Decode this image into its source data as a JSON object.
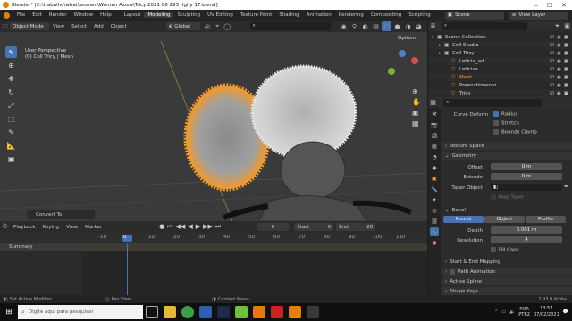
{
  "titlebar": {
    "title": "Blender* [C:\\trabalho\\what\\women\\Women Azora\\Tricy 2021 08 293 rigify 17.blend]"
  },
  "menus": [
    "File",
    "Edit",
    "Render",
    "Window",
    "Help"
  ],
  "workspaces": [
    "Layout",
    "Modeling",
    "Sculpting",
    "UV Editing",
    "Texture Paint",
    "Shading",
    "Animation",
    "Rendering",
    "Compositing",
    "Scripting"
  ],
  "scene": {
    "scene_label": "Scene",
    "view_layer_label": "View Layer"
  },
  "viewport": {
    "mode": "Object Mode",
    "menu": [
      "View",
      "Select",
      "Add",
      "Object"
    ],
    "orientation": "Global",
    "view_name": "User Perspective",
    "object_info": "(0) Coll Tricy | Mesh",
    "options_label": "Options",
    "convert_label": "Convert To"
  },
  "outliner": {
    "items": [
      {
        "label": "Scene Collection",
        "indent": 0
      },
      {
        "label": "Coll Studio",
        "indent": 1
      },
      {
        "label": "Coll Tricy",
        "indent": 1
      },
      {
        "label": "Leticia_ad",
        "indent": 2
      },
      {
        "label": "Leticias",
        "indent": 2
      },
      {
        "label": "Mesh",
        "indent": 2,
        "highlight": true
      },
      {
        "label": "Preenchimento",
        "indent": 2
      },
      {
        "label": "Tricy",
        "indent": 2
      }
    ]
  },
  "properties": {
    "curve_deform_label": "Curve Deform",
    "radius_label": "Radius",
    "stretch_label": "Stretch",
    "bounds_clamp_label": "Bounds Clamp",
    "texture_space": "Texture Space",
    "geometry": "Geometry",
    "offset_label": "Offset",
    "offset_value": "0 m",
    "extrude_label": "Extrude",
    "extrude_value": "0 m",
    "taper_label": "Taper Object",
    "map_taper_label": "Map Taper",
    "bevel": "Bevel",
    "bevel_tabs": [
      "Round",
      "Object",
      "Profile"
    ],
    "depth_label": "Depth",
    "depth_value": "0.001 m",
    "resolution_label": "Resolution",
    "resolution_value": "4",
    "fill_caps_label": "Fill Caps",
    "start_end_label": "Start & End Mapping",
    "path_anim": "Path Animation",
    "active_spline": "Active Spline",
    "shape_keys": "Shape Keys"
  },
  "timeline": {
    "menus": [
      "Playback",
      "Keying",
      "View",
      "Marker"
    ],
    "current_frame": "0",
    "start_label": "Start",
    "start_value": "0",
    "end_label": "End",
    "end_value": "20",
    "ruler": [
      "-10",
      "0",
      "10",
      "20",
      "30",
      "40",
      "50",
      "60",
      "70",
      "80",
      "90",
      "100",
      "110"
    ],
    "summary_label": "Summary"
  },
  "statusbar": {
    "left": "Set Active Modifier",
    "mid": "Pan View",
    "right": "Context Menu",
    "version": "2.93.0 Alpha"
  },
  "taskbar": {
    "search_placeholder": "Digite aqui para pesquisar",
    "lang": "POR\nPTB2",
    "time": "13:57",
    "date": "07/02/2021"
  },
  "colors": {
    "accent": "#4772b3",
    "selection_orange": "#f19a2d",
    "header": "#303030",
    "panel": "#2b2b2b"
  }
}
